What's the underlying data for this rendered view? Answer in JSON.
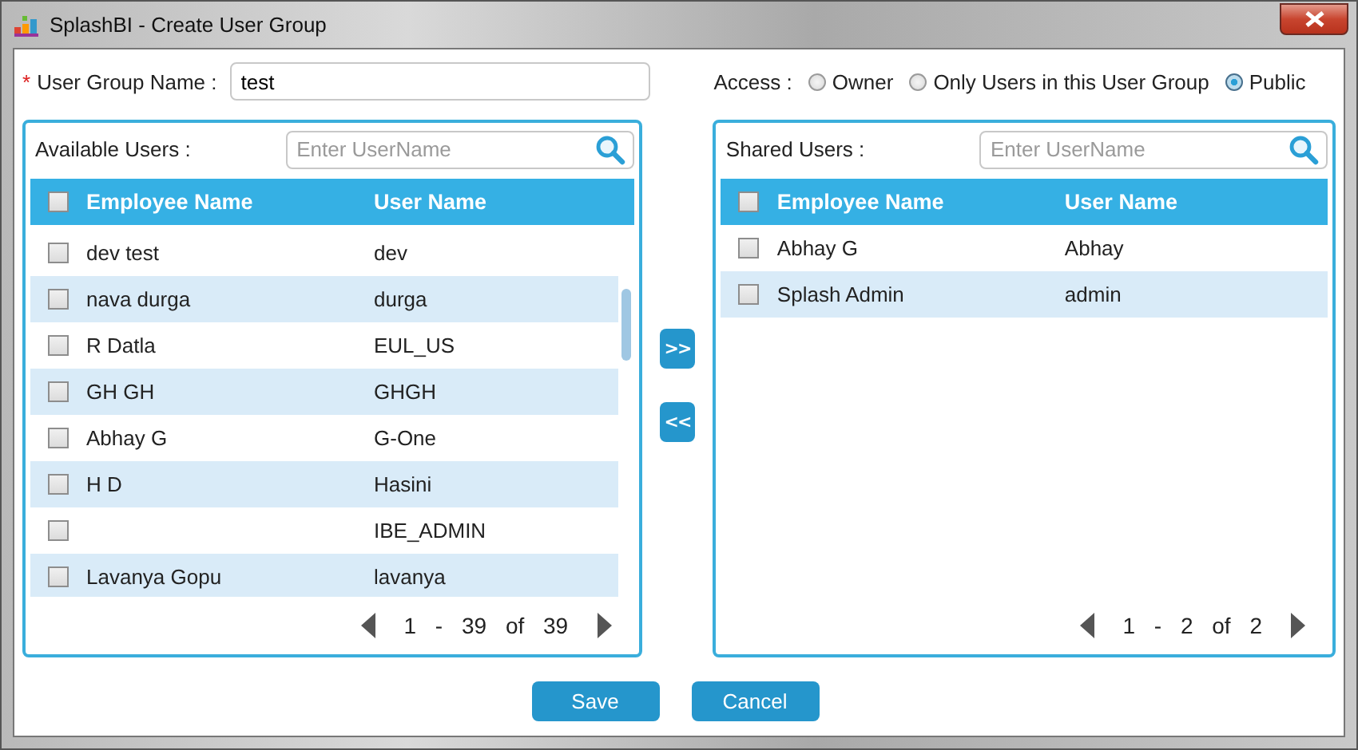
{
  "window": {
    "title": "SplashBI - Create User Group"
  },
  "group_name": {
    "label": "User Group Name :",
    "required_mark": "*",
    "value": "test"
  },
  "access": {
    "label": "Access :",
    "options": [
      {
        "label": "Owner",
        "selected": false
      },
      {
        "label": "Only Users in this User Group",
        "selected": false
      },
      {
        "label": "Public",
        "selected": true
      }
    ]
  },
  "available_users": {
    "label": "Available Users :",
    "search_placeholder": "Enter UserName",
    "header_checked": false,
    "columns": [
      "Employee Name",
      "User Name"
    ],
    "rows": [
      {
        "employee_name": "dev test",
        "user_name": "dev",
        "checked": false
      },
      {
        "employee_name": "nava durga",
        "user_name": "durga",
        "checked": false
      },
      {
        "employee_name": "R Datla",
        "user_name": "EUL_US",
        "checked": false
      },
      {
        "employee_name": "GH GH",
        "user_name": "GHGH",
        "checked": false
      },
      {
        "employee_name": "Abhay G",
        "user_name": "G-One",
        "checked": false
      },
      {
        "employee_name": "H D",
        "user_name": "Hasini",
        "checked": false
      },
      {
        "employee_name": "",
        "user_name": "IBE_ADMIN",
        "checked": false
      },
      {
        "employee_name": "Lavanya Gopu",
        "user_name": "lavanya",
        "checked": false
      }
    ],
    "pagination": {
      "from": "1",
      "dash": "-",
      "to": "39",
      "of": "of",
      "total": "39"
    }
  },
  "move_buttons": [
    ">>",
    "<<"
  ],
  "shared_users": {
    "label": "Shared Users :",
    "search_placeholder": "Enter UserName",
    "header_checked": false,
    "columns": [
      "Employee Name",
      "User Name"
    ],
    "rows": [
      {
        "employee_name": "Abhay G",
        "user_name": "Abhay",
        "checked": false
      },
      {
        "employee_name": "Splash Admin",
        "user_name": "admin",
        "checked": false
      }
    ],
    "pagination": {
      "from": "1",
      "dash": "-",
      "to": "2",
      "of": "of",
      "total": "2"
    }
  },
  "buttons": [
    "Save",
    "Cancel"
  ]
}
